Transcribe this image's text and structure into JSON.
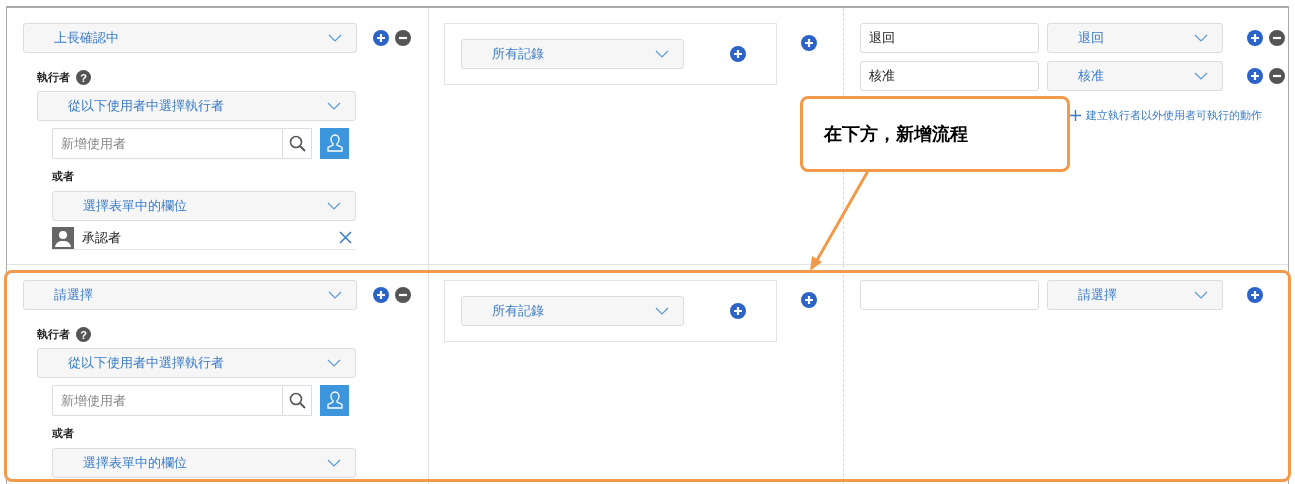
{
  "rows": [
    {
      "status": "上長確認中",
      "executor_label": "執行者",
      "help_icon": "?",
      "executor_mode": "從以下使用者中選擇執行者",
      "user_search": {
        "placeholder": "新增使用者"
      },
      "or_label": "或者",
      "field_select": "選擇表單中的欄位",
      "assignees": [
        {
          "name": "承認者"
        }
      ],
      "condition": "所有記錄",
      "actions": [
        {
          "name": "退回",
          "value": "退回",
          "removable": true
        },
        {
          "name": "核准",
          "value": "核准",
          "removable": true
        }
      ],
      "other_user_link": "建立執行者以外使用者可執行的動作",
      "highlighted": false
    },
    {
      "status": "請選擇",
      "executor_label": "執行者",
      "help_icon": "?",
      "executor_mode": "從以下使用者中選擇執行者",
      "user_search": {
        "placeholder": "新增使用者"
      },
      "or_label": "或者",
      "field_select": "選擇表單中的欄位",
      "assignees": [],
      "condition": "所有記錄",
      "actions": [
        {
          "value": "請選擇",
          "removable": false
        }
      ],
      "highlighted": true
    }
  ],
  "annotation": {
    "text": "在下方，新增流程"
  }
}
